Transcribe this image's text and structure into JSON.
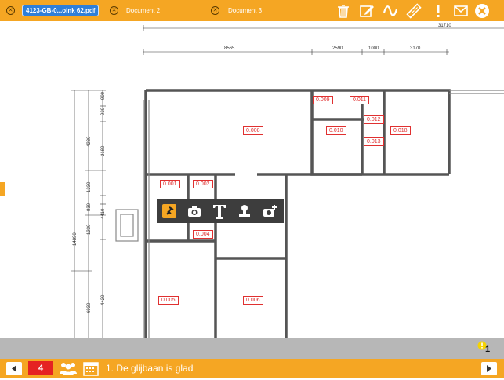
{
  "tabs": [
    {
      "label": "4123-GB-0...oink 62.pdf",
      "active": true
    },
    {
      "label": "Document 2",
      "active": false
    },
    {
      "label": "Document 3",
      "active": false
    }
  ],
  "toolbar_icons": [
    "trash-icon",
    "edit-icon",
    "squiggle-icon",
    "ruler-icon",
    "exclamation-icon",
    "mail-icon",
    "close-icon"
  ],
  "annotation_tools": [
    "pin-icon",
    "camera-icon",
    "text-icon",
    "stamp-icon",
    "camera-plus-icon"
  ],
  "plan": {
    "dimensions_top": [
      "31710"
    ],
    "dimensions_row": [
      "8565",
      "2590",
      "1000",
      "3170"
    ],
    "dimensions_left_a": [
      "900",
      "930",
      "4230",
      "2180",
      "1230",
      "830",
      "4410",
      "1230",
      "4420"
    ],
    "dimensions_left_b": [
      "14890",
      "6930"
    ],
    "rooms": [
      "0.009",
      "0.011",
      "0.008",
      "0.010",
      "0.012",
      "0.018",
      "0.013",
      "0.001",
      "0.002",
      "0.004",
      "0.005",
      "0.006"
    ]
  },
  "issue_badge": "1",
  "footer": {
    "page_number": "4",
    "issue_title": "1. De glijbaan is glad"
  },
  "colors": {
    "accent": "#f5a623",
    "tab_active": "#2f7fd9",
    "room_red": "#e03030"
  }
}
